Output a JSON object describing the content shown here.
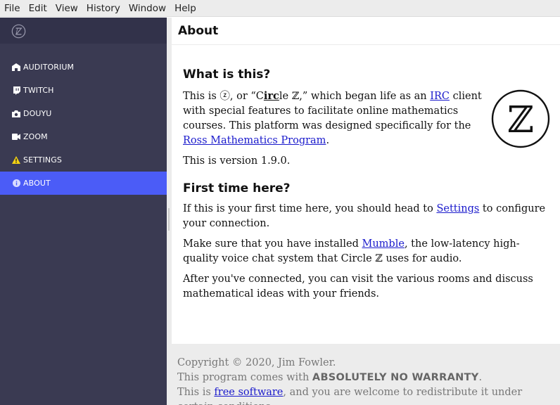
{
  "menubar": {
    "items": [
      "File",
      "Edit",
      "View",
      "History",
      "Window",
      "Help"
    ]
  },
  "sidebar": {
    "items": [
      {
        "label": "AUDITORIUM",
        "icon": "auditorium-icon"
      },
      {
        "label": "TWITCH",
        "icon": "twitch-icon"
      },
      {
        "label": "DOUYU",
        "icon": "camera-icon"
      },
      {
        "label": "ZOOM",
        "icon": "video-camera-icon"
      },
      {
        "label": "SETTINGS",
        "icon": "warning-icon"
      },
      {
        "label": "ABOUT",
        "icon": "info-icon"
      }
    ],
    "active": "ABOUT",
    "accent": "#4b5cf7",
    "background": "#3a3a52"
  },
  "header": {
    "title": "About"
  },
  "about": {
    "what_heading": "What is this?",
    "intro_1": "This is ",
    "intro_circle": "ⓩ",
    "intro_2": ", or “C",
    "intro_irc": "irc",
    "intro_3": "le ℤ,” which began life as an ",
    "intro_irc_link": "IRC",
    "intro_4": " client with special features to facilitate online mathematics courses. This platform was designed specifically for the ",
    "intro_ross_link": "Ross Mathematics Program",
    "intro_5": ".",
    "version_text": "This is version 1.9.0.",
    "first_heading": "First time here?",
    "first_1": "If this is your first time here, you should head to ",
    "first_settings_link": "Settings",
    "first_2": " to configure your connection.",
    "mumble_1": "Make sure that you have installed ",
    "mumble_link": "Mumble",
    "mumble_2": ", the low-latency high-quality voice chat system that Circle ℤ uses for audio.",
    "after_text": "After you've connected, you can visit the various rooms and discuss mathematical ideas with your friends.",
    "logo_letter": "ℤ"
  },
  "footer": {
    "copyright": "Copyright © 2020, Jim Fowler.",
    "warranty_1": "This program comes with ",
    "warranty_strong": "ABSOLUTELY NO WARRANTY",
    "warranty_2": ".",
    "free_1": "This is ",
    "free_link": "free software",
    "free_2": ", and you are welcome to redistribute it under certain conditions."
  }
}
